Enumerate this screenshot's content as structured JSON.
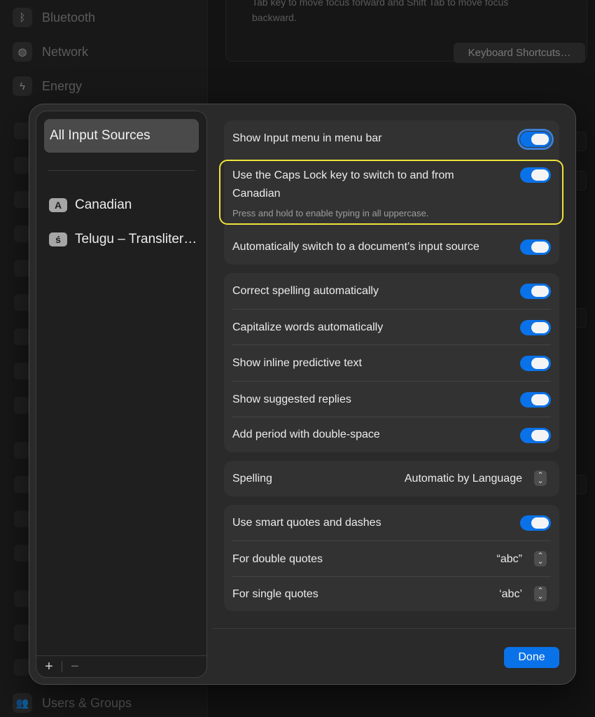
{
  "background": {
    "sidebar_items": [
      {
        "label": "Bluetooth",
        "icon": "bluetooth-icon"
      },
      {
        "label": "Network",
        "icon": "globe-icon"
      },
      {
        "label": "Energy",
        "icon": "bolt-icon"
      }
    ],
    "bottom_item": {
      "label": "Users & Groups",
      "icon": "users-icon"
    },
    "hint_text": "Tab key to move focus forward and Shift Tab to move focus backward.",
    "shortcuts_button": "Keyboard Shortcuts…"
  },
  "sidebar": {
    "all_sources": "All Input Sources",
    "sources": [
      {
        "badge": "A",
        "label": "Canadian"
      },
      {
        "badge": "ś",
        "label": "Telugu – Transliter…"
      }
    ],
    "add_label": "+",
    "remove_label": "−"
  },
  "settings": {
    "input_menu": {
      "label": "Show Input menu in menu bar",
      "on": true
    },
    "caps_lock": {
      "label": "Use the Caps Lock key to switch to and from Canadian",
      "description": "Press and hold to enable typing in all uppercase.",
      "on": true
    },
    "auto_switch": {
      "label": "Automatically switch to a document’s input source",
      "on": true
    },
    "correct_spelling": {
      "label": "Correct spelling automatically",
      "on": true
    },
    "capitalize": {
      "label": "Capitalize words automatically",
      "on": true
    },
    "predictive": {
      "label": "Show inline predictive text",
      "on": true
    },
    "suggested_replies": {
      "label": "Show suggested replies",
      "on": true
    },
    "period": {
      "label": "Add period with double-space",
      "on": true
    },
    "spelling": {
      "label": "Spelling",
      "value": "Automatic by Language"
    },
    "smart_quotes": {
      "label": "Use smart quotes and dashes",
      "on": true
    },
    "double_quotes": {
      "label": "For double quotes",
      "value": "“abc”"
    },
    "single_quotes": {
      "label": "For single quotes",
      "value": "‘abc’"
    }
  },
  "done_label": "Done",
  "colors": {
    "accent": "#0a72e8",
    "highlight": "#f0e23a"
  }
}
